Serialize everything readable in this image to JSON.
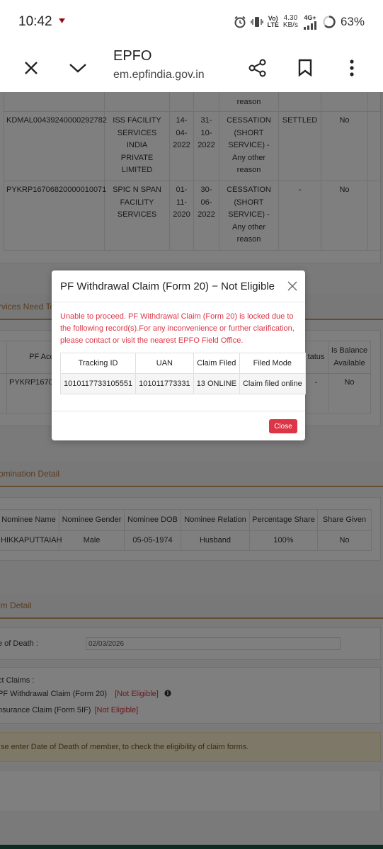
{
  "status_bar": {
    "time": "10:42",
    "network_top": "Vo)",
    "network_bottom": "LTE",
    "speed_value": "4.30",
    "speed_unit": "KB/s",
    "signal_type": "4G+",
    "battery": "63%"
  },
  "browser": {
    "title": "EPFO",
    "url": "em.epfindia.gov.in"
  },
  "employment_table": {
    "partial_row": [
      "reason"
    ],
    "rows": [
      {
        "member_id": "KDMAL00439240000292782",
        "establishment": [
          "ISS FACILITY",
          "SERVICES INDIA",
          "PRIVATE",
          "LIMITED"
        ],
        "doj": [
          "14-",
          "04-",
          "2022"
        ],
        "doe": [
          "31-",
          "10-",
          "2022"
        ],
        "reason": [
          "CESSATION",
          "(SHORT",
          "SERVICE) -",
          "Any other",
          "reason"
        ],
        "status": "SETTLED",
        "flag": "No"
      },
      {
        "member_id": "PYKRP16706820000010071",
        "establishment": [
          "SPIC N SPAN",
          "FACILITY",
          "SERVICES"
        ],
        "doj": [
          "01-",
          "11-",
          "2020"
        ],
        "doe": [
          "30-",
          "06-",
          "2022"
        ],
        "reason": [
          "CESSATION",
          "(SHORT",
          "SERVICE) -",
          "Any other",
          "reason"
        ],
        "status": "-",
        "flag": "No"
      }
    ]
  },
  "services_section": {
    "title": "rvices Need To",
    "headers": {
      "col0": "",
      "col1": "PF Acc",
      "status": "tatus",
      "balance": [
        "Is Balance",
        "Available"
      ]
    },
    "row": {
      "account": "PYKRP16706",
      "status": "-",
      "balance": "No"
    }
  },
  "nomination_section": {
    "title": "omination Detail",
    "headers": [
      "Nominee Name",
      "Nominee Gender",
      "Nominee DOB",
      "Nominee Relation",
      "Percentage Share",
      "Share Given"
    ],
    "row": [
      "HIKKAPUTTAIAH",
      "Male",
      "05-05-1974",
      "Husband",
      "100%",
      "No"
    ]
  },
  "claim_section": {
    "title": "im Detail",
    "date_of_death_label": "e of Death :",
    "date_of_death_value": "02/03/2026",
    "select_claims_label": "ct Claims :",
    "claims": [
      {
        "label": "PF Withdrawal Claim (Form 20)",
        "status": "[Not Eligible]"
      },
      {
        "label": "nsurance Claim (Form 5IF)",
        "status": "[Not Eligible]"
      }
    ],
    "info_text": "se enter Date of Death of member, to check the eligibility of claim forms."
  },
  "modal": {
    "title": "PF Withdrawal Claim (Form 20)  −  Not Eligible",
    "message": "Unable to proceed. PF Withdrawal Claim (Form 20) is locked due to the following record(s).For any inconvenience or further clarification, please contact or visit the nearest EPFO Field Office.",
    "table_headers": [
      "Tracking ID",
      "UAN",
      "Claim Filed",
      "Filed Mode"
    ],
    "table_row": [
      "1010117733105551",
      "101011773331",
      "13 ONLINE",
      "Claim filed online"
    ],
    "close_label": "Close"
  },
  "colors": {
    "accent_brown": "#b07a3e",
    "error_red": "#dc3545",
    "overlay": "rgba(0,0,0,0.5)"
  }
}
